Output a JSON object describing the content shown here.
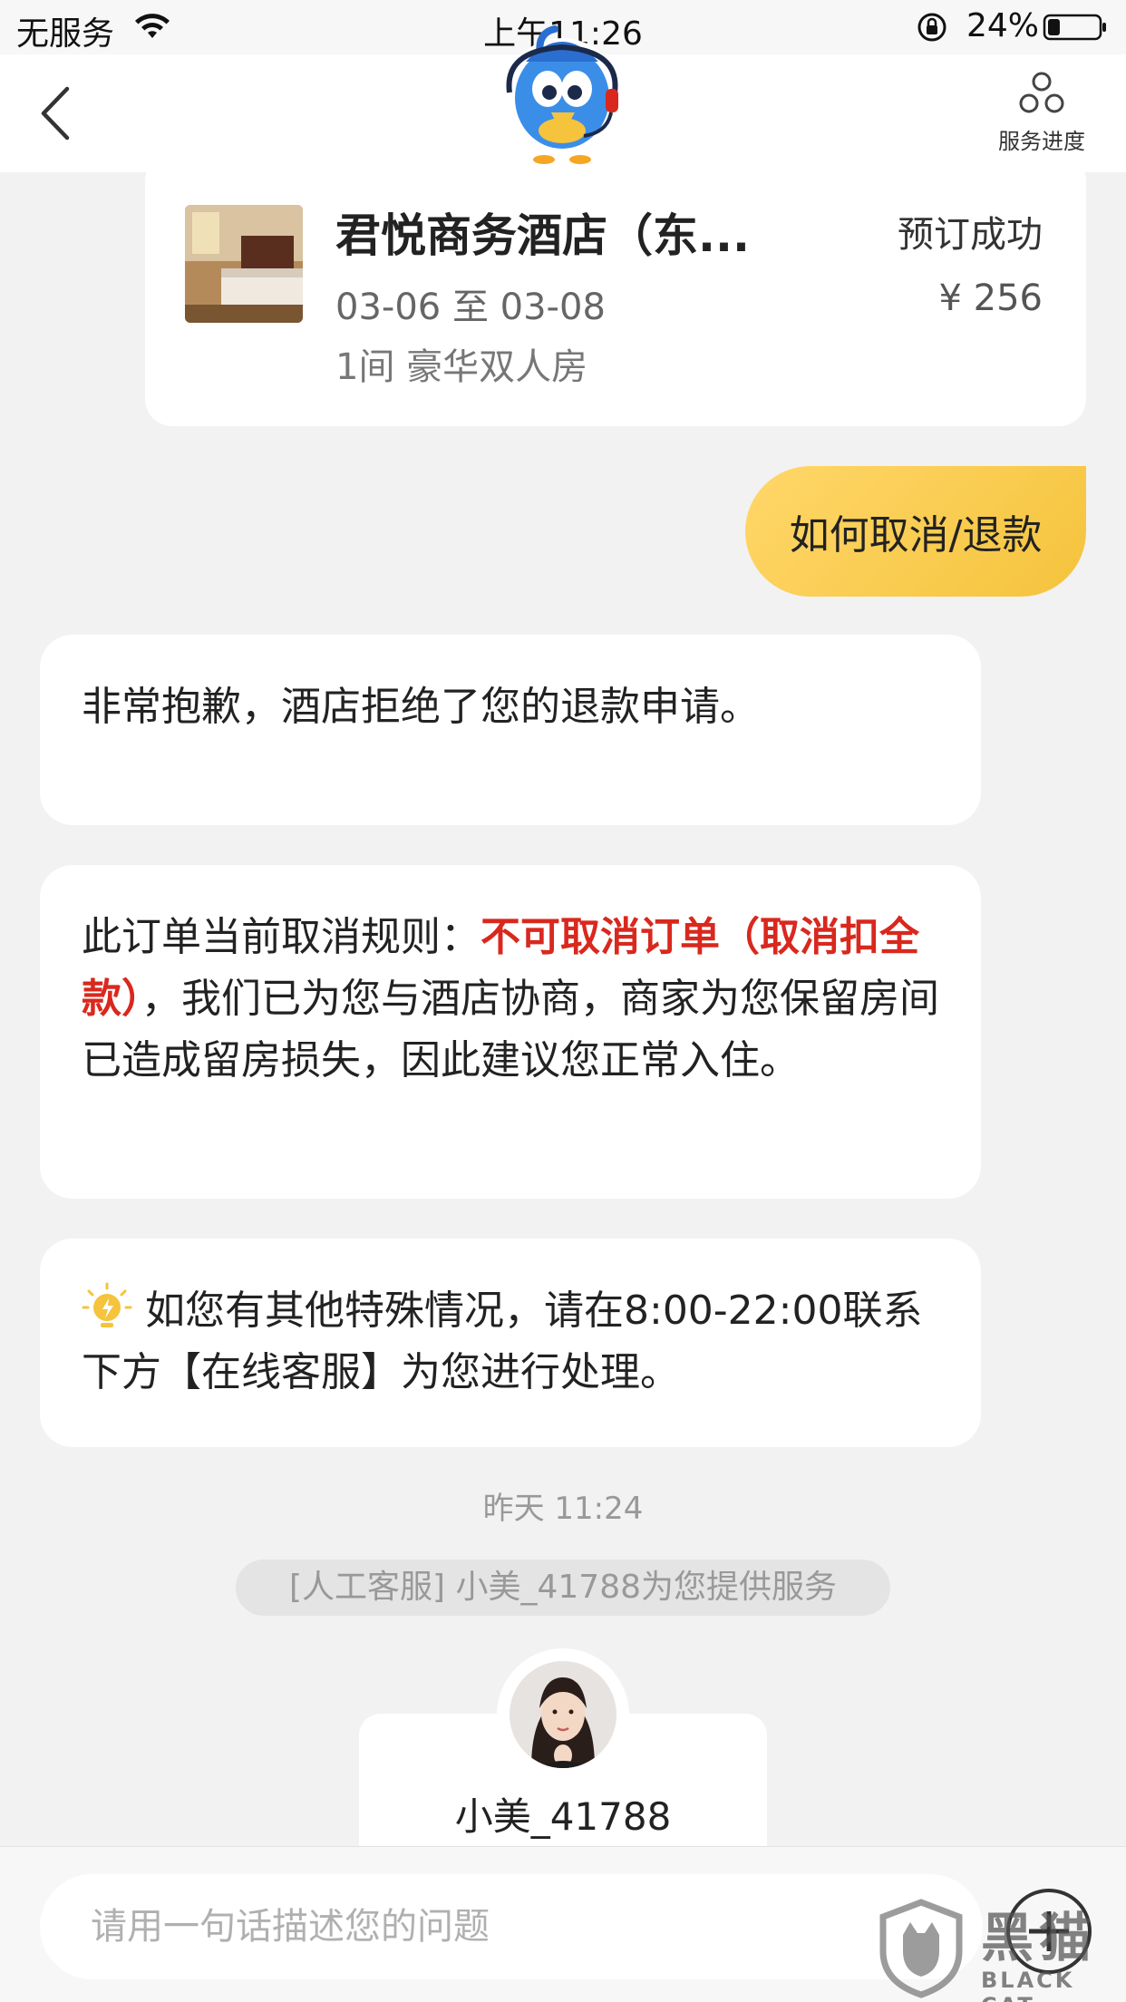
{
  "status_bar": {
    "carrier": "无服务",
    "time": "上午11:26",
    "battery_percent": "24%",
    "battery_level": 0.24,
    "icons": [
      "wifi-icon",
      "orientation-lock-icon",
      "battery-icon"
    ]
  },
  "nav": {
    "back_icon": "chevron-left-icon",
    "mascot_icon": "service-mascot-icon",
    "progress_icon": "service-progress-icon",
    "progress_label": "服务进度"
  },
  "order": {
    "hotel_name": "君悦商务酒店（东...",
    "status": "预订成功",
    "dates": "03-06 至 03-08",
    "price": "¥ 256",
    "room": "1间 豪华双人房"
  },
  "chat": {
    "user_message": "如何取消/退款",
    "bot_message_1": "非常抱歉，酒店拒绝了您的退款申请。",
    "bot_message_2": {
      "prefix": "此订单当前取消规则：",
      "highlight": "不可取消订单（取消扣全款）",
      "suffix": "，我们已为您与酒店协商，商家为您保留房间已造成留房损失，因此建议您正常入住。"
    },
    "bot_message_3": "如您有其他特殊情况，请在8:00-22:00联系下方【在线客服】为您进行处理。",
    "timestamp": "昨天 11:24",
    "agent_notice": "[人工客服] 小美_41788为您提供服务",
    "agent_name": "小美_41788"
  },
  "input": {
    "placeholder": "请用一句话描述您的问题",
    "value": ""
  },
  "watermark": {
    "text_cn": "黑猫",
    "text_en": "BLACK CAT"
  },
  "colors": {
    "accent_yellow": "#f5c33c",
    "highlight_red": "#d9281e",
    "background": "#f2f2f2"
  }
}
